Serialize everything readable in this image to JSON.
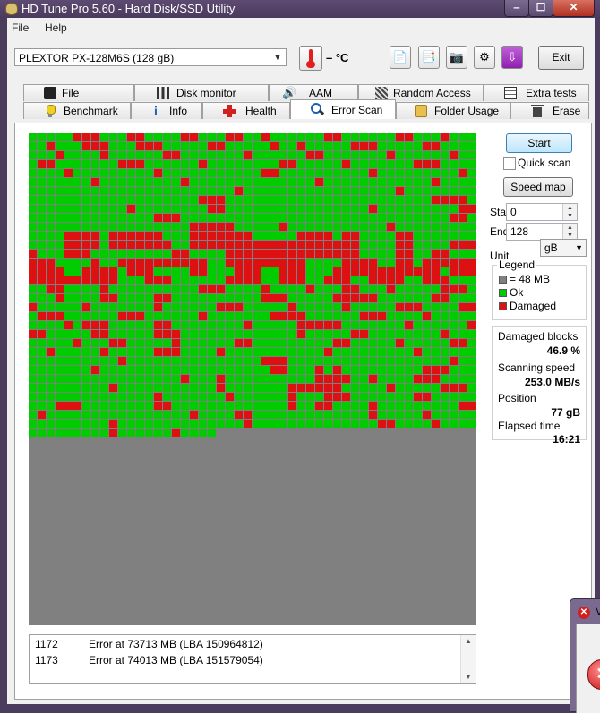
{
  "window": {
    "title": "HD Tune Pro 5.60 - Hard Disk/SSD Utility",
    "controls": {
      "minimize": "‒",
      "maximize": "☐",
      "close": "✕"
    }
  },
  "menu": {
    "file": "File",
    "help": "Help"
  },
  "toolbar": {
    "drive": "PLEXTOR PX-128M6S (128 gB)",
    "temperature": "– °C",
    "exit_label": "Exit"
  },
  "tabs_top": [
    {
      "label": "File Benchmark",
      "icon": "file-benchmark-icon"
    },
    {
      "label": "Disk monitor",
      "icon": "disk-monitor-icon"
    },
    {
      "label": "AAM",
      "icon": "speaker-icon"
    },
    {
      "label": "Random Access",
      "icon": "random-access-icon"
    },
    {
      "label": "Extra tests",
      "icon": "extra-tests-icon"
    }
  ],
  "tabs_bottom": [
    {
      "label": "Benchmark",
      "icon": "lightbulb-icon"
    },
    {
      "label": "Info",
      "icon": "info-icon"
    },
    {
      "label": "Health",
      "icon": "health-cross-icon"
    },
    {
      "label": "Error Scan",
      "icon": "magnifier-icon",
      "active": true
    },
    {
      "label": "Folder Usage",
      "icon": "folder-icon"
    },
    {
      "label": "Erase",
      "icon": "trash-icon"
    }
  ],
  "scan": {
    "start_label": "Start",
    "quick_scan_label": "Quick scan",
    "quick_scan_checked": false,
    "speed_map_label": "Speed map",
    "start_field_label": "Start",
    "start_value": "0",
    "end_field_label": "End",
    "end_value": "128",
    "unit_label": "Unit",
    "unit_value": "gB"
  },
  "legend": {
    "title": "Legend",
    "block_label": "= 48 MB",
    "ok_label": "Ok",
    "damaged_label": "Damaged",
    "colors": {
      "untested": "#808080",
      "ok": "#00cc00",
      "damaged": "#dd1111"
    }
  },
  "stats": {
    "damaged_blocks_label": "Damaged blocks",
    "damaged_blocks_value": "46.9 %",
    "scanning_speed_label": "Scanning speed",
    "scanning_speed_value": "253.0 MB/s",
    "position_label": "Position",
    "position_value": "77 gB",
    "elapsed_label": "Elapsed time",
    "elapsed_value": "16:21"
  },
  "block_map": {
    "columns": 50,
    "rows": 55,
    "scanned_full_rows": 33,
    "partial_row_cells": 21,
    "damaged_runs": [
      [
        0,
        5,
        7
      ],
      [
        0,
        11,
        12
      ],
      [
        0,
        17,
        18
      ],
      [
        0,
        22,
        23
      ],
      [
        0,
        26,
        26
      ],
      [
        0,
        33,
        34
      ],
      [
        0,
        41,
        42
      ],
      [
        0,
        46,
        46
      ],
      [
        1,
        2,
        2
      ],
      [
        1,
        6,
        8
      ],
      [
        1,
        12,
        14
      ],
      [
        1,
        20,
        21
      ],
      [
        1,
        27,
        27
      ],
      [
        1,
        30,
        30
      ],
      [
        1,
        36,
        38
      ],
      [
        1,
        44,
        45
      ],
      [
        2,
        3,
        3
      ],
      [
        2,
        8,
        8
      ],
      [
        2,
        15,
        16
      ],
      [
        2,
        24,
        24
      ],
      [
        2,
        31,
        32
      ],
      [
        2,
        40,
        40
      ],
      [
        2,
        47,
        47
      ],
      [
        3,
        1,
        2
      ],
      [
        3,
        10,
        12
      ],
      [
        3,
        19,
        19
      ],
      [
        3,
        28,
        29
      ],
      [
        3,
        35,
        35
      ],
      [
        3,
        43,
        45
      ],
      [
        4,
        4,
        4
      ],
      [
        4,
        14,
        14
      ],
      [
        4,
        26,
        27
      ],
      [
        4,
        38,
        38
      ],
      [
        4,
        48,
        48
      ],
      [
        5,
        7,
        7
      ],
      [
        5,
        17,
        17
      ],
      [
        5,
        32,
        32
      ],
      [
        5,
        45,
        45
      ],
      [
        6,
        23,
        23
      ],
      [
        6,
        41,
        41
      ],
      [
        7,
        19,
        21
      ],
      [
        7,
        45,
        48
      ],
      [
        8,
        11,
        11
      ],
      [
        8,
        20,
        21
      ],
      [
        8,
        38,
        38
      ],
      [
        8,
        48,
        49
      ],
      [
        9,
        14,
        16
      ],
      [
        9,
        47,
        48
      ],
      [
        10,
        18,
        22
      ],
      [
        10,
        28,
        28
      ],
      [
        10,
        40,
        40
      ],
      [
        11,
        4,
        7
      ],
      [
        11,
        9,
        14
      ],
      [
        11,
        18,
        24
      ],
      [
        11,
        30,
        33
      ],
      [
        11,
        35,
        36
      ],
      [
        11,
        41,
        42
      ],
      [
        12,
        4,
        7
      ],
      [
        12,
        9,
        15
      ],
      [
        12,
        18,
        36
      ],
      [
        12,
        41,
        42
      ],
      [
        12,
        47,
        49
      ],
      [
        13,
        0,
        0
      ],
      [
        13,
        4,
        6
      ],
      [
        13,
        16,
        17
      ],
      [
        13,
        22,
        36
      ],
      [
        13,
        41,
        42
      ],
      [
        13,
        45,
        46
      ],
      [
        14,
        0,
        2
      ],
      [
        14,
        7,
        7
      ],
      [
        14,
        10,
        19
      ],
      [
        14,
        22,
        30
      ],
      [
        14,
        35,
        38
      ],
      [
        14,
        41,
        42
      ],
      [
        14,
        44,
        49
      ],
      [
        15,
        0,
        3
      ],
      [
        15,
        6,
        9
      ],
      [
        15,
        11,
        13
      ],
      [
        15,
        18,
        19
      ],
      [
        15,
        23,
        25
      ],
      [
        15,
        28,
        30
      ],
      [
        15,
        34,
        36
      ],
      [
        15,
        37,
        45
      ],
      [
        15,
        47,
        49
      ],
      [
        16,
        0,
        9
      ],
      [
        16,
        13,
        15
      ],
      [
        16,
        22,
        25
      ],
      [
        16,
        28,
        30
      ],
      [
        16,
        33,
        35
      ],
      [
        16,
        38,
        41
      ],
      [
        16,
        44,
        46
      ],
      [
        17,
        2,
        3
      ],
      [
        17,
        8,
        8
      ],
      [
        17,
        19,
        21
      ],
      [
        17,
        26,
        26
      ],
      [
        17,
        31,
        31
      ],
      [
        17,
        35,
        36
      ],
      [
        17,
        40,
        40
      ],
      [
        17,
        46,
        48
      ],
      [
        18,
        3,
        3
      ],
      [
        18,
        8,
        9
      ],
      [
        18,
        14,
        15
      ],
      [
        18,
        26,
        28
      ],
      [
        18,
        34,
        38
      ],
      [
        18,
        45,
        46
      ],
      [
        19,
        0,
        0
      ],
      [
        19,
        6,
        6
      ],
      [
        19,
        14,
        14
      ],
      [
        19,
        21,
        23
      ],
      [
        19,
        29,
        29
      ],
      [
        19,
        35,
        35
      ],
      [
        19,
        41,
        43
      ],
      [
        19,
        48,
        49
      ],
      [
        20,
        1,
        3
      ],
      [
        20,
        10,
        12
      ],
      [
        20,
        19,
        19
      ],
      [
        20,
        27,
        30
      ],
      [
        20,
        37,
        39
      ],
      [
        20,
        44,
        44
      ],
      [
        21,
        4,
        4
      ],
      [
        21,
        6,
        8
      ],
      [
        21,
        14,
        15
      ],
      [
        21,
        24,
        24
      ],
      [
        21,
        30,
        34
      ],
      [
        21,
        42,
        42
      ],
      [
        21,
        49,
        49
      ],
      [
        22,
        0,
        1
      ],
      [
        22,
        7,
        8
      ],
      [
        22,
        14,
        16
      ],
      [
        22,
        30,
        30
      ],
      [
        22,
        36,
        37
      ],
      [
        22,
        46,
        46
      ],
      [
        23,
        5,
        5
      ],
      [
        23,
        9,
        10
      ],
      [
        23,
        16,
        16
      ],
      [
        23,
        23,
        24
      ],
      [
        23,
        34,
        35
      ],
      [
        23,
        41,
        41
      ],
      [
        23,
        47,
        48
      ],
      [
        24,
        2,
        2
      ],
      [
        24,
        8,
        8
      ],
      [
        24,
        14,
        16
      ],
      [
        24,
        21,
        21
      ],
      [
        24,
        33,
        33
      ],
      [
        24,
        43,
        43
      ],
      [
        25,
        10,
        10
      ],
      [
        25,
        26,
        28
      ],
      [
        25,
        47,
        47
      ],
      [
        26,
        7,
        7
      ],
      [
        26,
        27,
        28
      ],
      [
        26,
        32,
        32
      ],
      [
        26,
        34,
        34
      ],
      [
        26,
        44,
        46
      ],
      [
        27,
        17,
        17
      ],
      [
        27,
        21,
        21
      ],
      [
        27,
        32,
        35
      ],
      [
        27,
        38,
        38
      ],
      [
        27,
        43,
        45
      ],
      [
        28,
        9,
        9
      ],
      [
        28,
        21,
        21
      ],
      [
        28,
        29,
        34
      ],
      [
        28,
        40,
        40
      ],
      [
        28,
        46,
        48
      ],
      [
        29,
        14,
        14
      ],
      [
        29,
        22,
        22
      ],
      [
        29,
        29,
        29
      ],
      [
        29,
        33,
        35
      ],
      [
        29,
        43,
        44
      ],
      [
        30,
        3,
        5
      ],
      [
        30,
        14,
        15
      ],
      [
        30,
        29,
        29
      ],
      [
        30,
        32,
        33
      ],
      [
        30,
        38,
        38
      ],
      [
        30,
        48,
        49
      ],
      [
        31,
        1,
        1
      ],
      [
        31,
        18,
        18
      ],
      [
        31,
        23,
        24
      ],
      [
        31,
        38,
        38
      ],
      [
        31,
        44,
        44
      ],
      [
        32,
        9,
        9
      ],
      [
        32,
        24,
        24
      ],
      [
        32,
        39,
        40
      ],
      [
        32,
        45,
        45
      ],
      [
        33,
        9,
        9
      ],
      [
        33,
        16,
        16
      ]
    ]
  },
  "log": [
    {
      "num": "1172",
      "msg": "Error at 73713 MB (LBA 150964812)"
    },
    {
      "num": "1173",
      "msg": "Error at 74013 MB (LBA 151579054)"
    }
  ],
  "error_dialog": {
    "title": "M"
  }
}
